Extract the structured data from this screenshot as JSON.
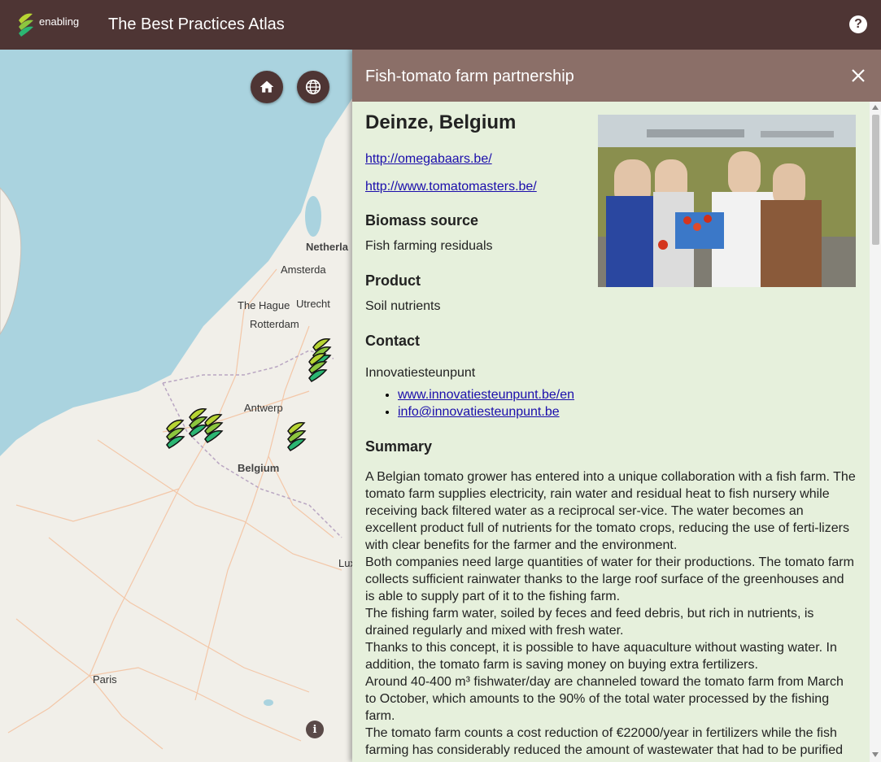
{
  "header": {
    "logo_text": "enabling",
    "app_title": "The Best Practices Atlas",
    "help_icon": "help-icon"
  },
  "map": {
    "labels": {
      "netherlands": "Netherla",
      "amsterda": "Amsterda",
      "the_hague": "The Hague",
      "utrecht": "Utrecht",
      "rotterdam": "Rotterdam",
      "antwerp": "Antwerp",
      "belgium": "Belgium",
      "lux": "Lux",
      "paris": "Paris"
    },
    "home_icon": "home-icon",
    "globe_icon": "globe-icon",
    "info_label": "i"
  },
  "panel": {
    "title": "Fish-tomato farm partnership",
    "location": "Deinze, Belgium",
    "links": [
      "http://omegabaars.be/",
      "http://www.tomatomasters.be/"
    ],
    "biomass_heading": "Biomass source",
    "biomass_value": "Fish farming residuals",
    "product_heading": "Product",
    "product_value": "Soil nutrients",
    "contact_heading": "Contact",
    "contact_name": "Innovatiesteunpunt",
    "contact_items": [
      "www.innovatiesteunpunt.be/en",
      "info@innovatiesteunpunt.be"
    ],
    "summary_heading": "Summary",
    "summary_paragraphs": [
      "A Belgian tomato grower has entered into a unique collaboration with a fish farm. The tomato farm supplies electricity, rain water and residual heat to fish nursery while receiving back filtered water as a reciprocal ser-vice. The water becomes an excellent product full of nutrients for the tomato crops, reducing the use of ferti-lizers with clear benefits for the farmer and the environment.",
      "Both companies need large quantities of water for their productions. The tomato farm collects sufficient rainwater thanks to the large roof surface of the greenhouses and is able to supply part of it to the fishing farm.",
      "The fishing farm water, soiled by feces and feed debris, but rich in nutrients, is drained regularly and mixed with fresh water.",
      "Thanks to this concept, it is possible to have aquaculture without wasting water. In addition, the tomato farm is saving money on buying extra fertilizers.",
      "Around 40-400 m³ fishwater/day are channeled toward the tomato farm from March to October, which amounts to the 90% of the total water processed by the fishing farm.",
      "The tomato farm counts a cost reduction of €22000/year in fertilizers while the fish farming has considerably reduced the amount of wastewater that had to be purified"
    ]
  }
}
